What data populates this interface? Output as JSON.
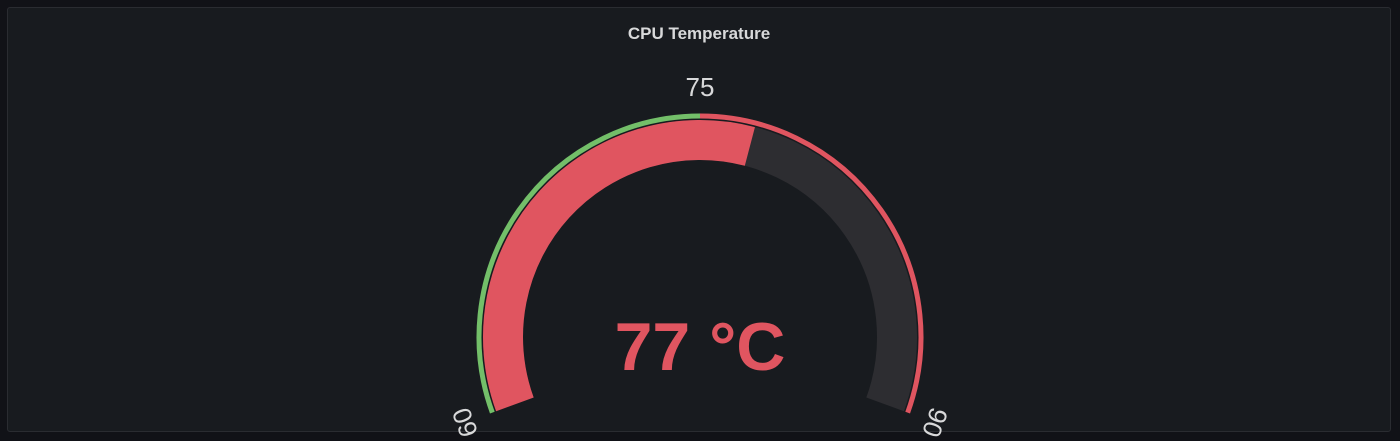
{
  "panel": {
    "title": "CPU Temperature"
  },
  "chart_data": {
    "type": "gauge",
    "min": 60,
    "max": 90,
    "value": 77,
    "unit": "°C",
    "display_value": "77 °C",
    "thresholds": [
      {
        "from": 60,
        "to": 75,
        "color": "#73bf69"
      },
      {
        "from": 75,
        "to": 90,
        "color": "#e05560"
      }
    ],
    "threshold_labels": [
      "60",
      "75",
      "90"
    ],
    "value_color": "#e05560",
    "track_color": "#2d2d31"
  }
}
